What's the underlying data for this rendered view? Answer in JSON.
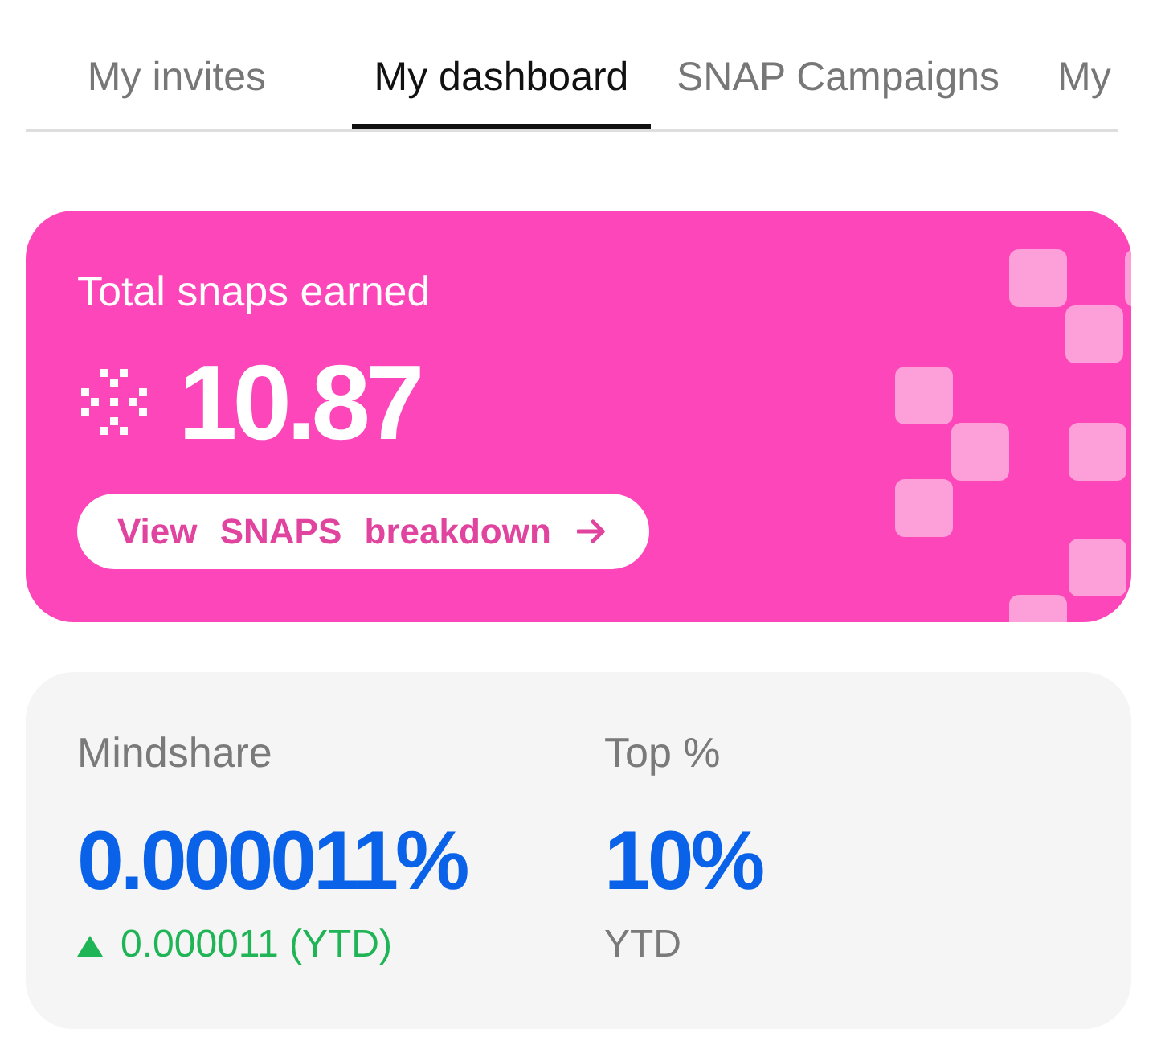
{
  "tabs": [
    {
      "label": "My invites",
      "selected": false
    },
    {
      "label": "My dashboard",
      "selected": true
    },
    {
      "label": "SNAP Campaigns",
      "selected": false
    },
    {
      "label": "My",
      "selected": false
    }
  ],
  "snaps_card": {
    "title": "Total snaps earned",
    "value": "10.87",
    "button": "View SNAPS breakdown"
  },
  "stats_card": {
    "stats": [
      {
        "label": "Mindshare",
        "value": "0.000011%",
        "sub": {
          "kind": "up",
          "text": "0.000011 (YTD)"
        }
      },
      {
        "label": "Top %",
        "value": "10%",
        "sub": {
          "kind": "plain",
          "text": "YTD"
        }
      }
    ]
  }
}
